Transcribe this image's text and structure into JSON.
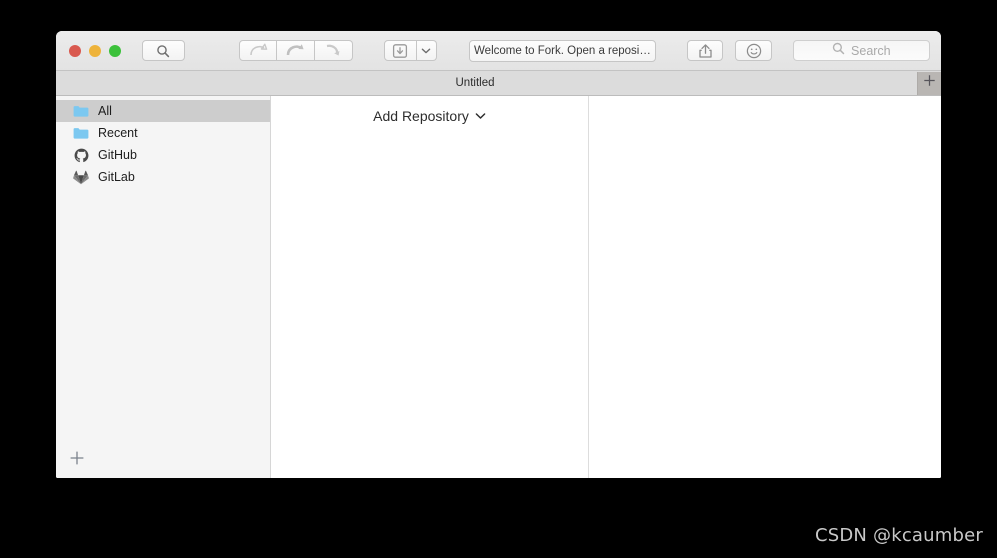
{
  "window": {
    "traffic_lights": {
      "close_label": "Close",
      "minimize_label": "Minimize",
      "maximize_label": "Zoom",
      "close_color": "#d9594f",
      "minimize_color": "#eeb33b",
      "maximize_color": "#3cc13b"
    },
    "toolbar": {
      "search_button_icon": "magnifier-icon",
      "pull_button_icon": "pull-arrow-icon",
      "fetch_button_icon": "fetch-arrow-icon",
      "push_button_icon": "push-arrow-icon",
      "stash_button_icon": "stash-box-icon",
      "stash_caret_icon": "chevron-down-icon",
      "title": "Welcome to Fork. Open a reposi…",
      "share_button_icon": "share-icon",
      "emoji_button_icon": "smiley-icon",
      "search": {
        "value": "",
        "placeholder": "Search",
        "icon": "search-icon"
      }
    },
    "tabbar": {
      "tab_label": "Untitled",
      "add_tab_label": "+"
    }
  },
  "sidebar": {
    "items": [
      {
        "label": "All",
        "icon": "folder-icon",
        "selected": true
      },
      {
        "label": "Recent",
        "icon": "folder-icon",
        "selected": false
      },
      {
        "label": "GitHub",
        "icon": "github-icon",
        "selected": false
      },
      {
        "label": "GitLab",
        "icon": "gitlab-icon",
        "selected": false
      }
    ],
    "add_button_label": "+",
    "folder_color": "#7cc8f0",
    "selection_color": "#cdcdcd"
  },
  "content": {
    "add_repository_label": "Add Repository",
    "add_repository_caret_icon": "chevron-down-icon"
  },
  "watermark": {
    "text": "CSDN @kcaumber"
  }
}
